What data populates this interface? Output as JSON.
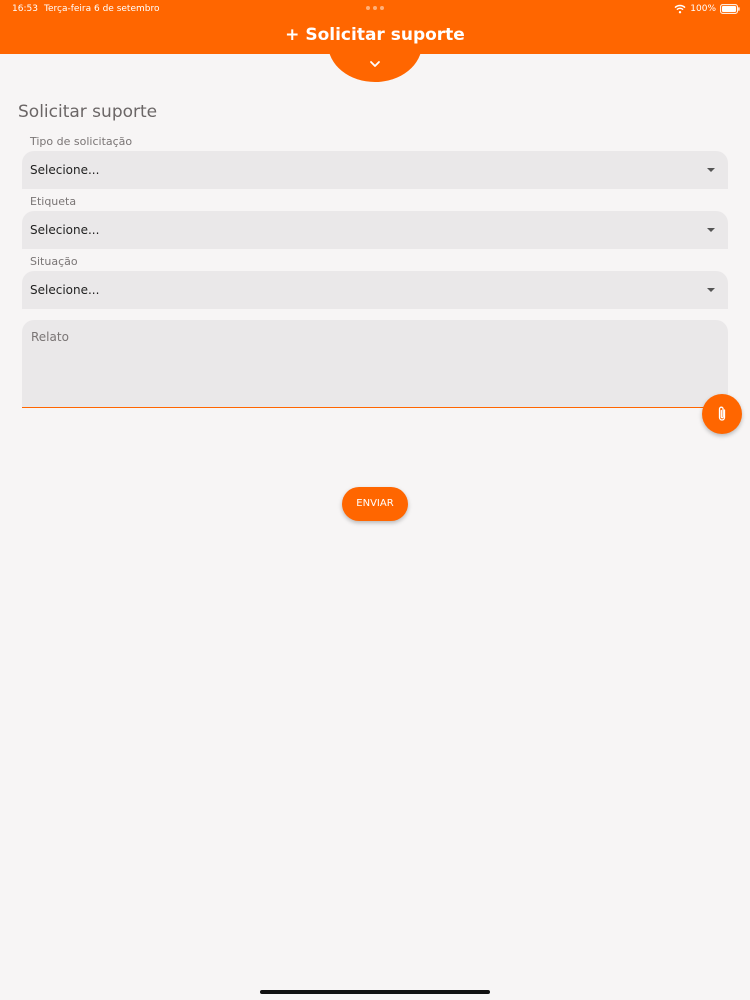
{
  "status_bar": {
    "time": "16:53",
    "date": "Terça-feira 6 de setembro",
    "battery": "100%",
    "wifi_icon": "wifi-icon",
    "battery_icon": "battery-icon"
  },
  "header": {
    "title": "+ Solicitar suporte",
    "collapse_icon": "chevron-down-icon",
    "color": "#ff6600"
  },
  "form": {
    "title": "Solicitar suporte",
    "fields": [
      {
        "label": "Tipo de solicitação",
        "value": "Selecione..."
      },
      {
        "label": "Etiqueta",
        "value": "Selecione..."
      },
      {
        "label": "Situação",
        "value": "Selecione..."
      }
    ],
    "report": {
      "placeholder": "Relato"
    },
    "attach_icon": "paperclip-icon",
    "submit_label": "ENVIAR"
  }
}
